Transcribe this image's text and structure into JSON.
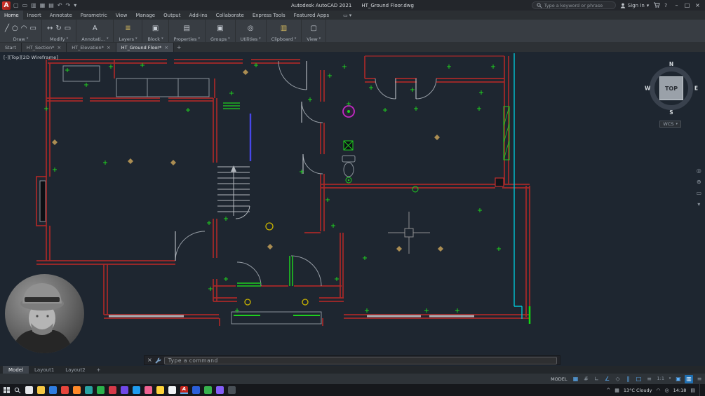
{
  "titlebar": {
    "app_name": "Autodesk AutoCAD 2021",
    "doc_name": "HT_Ground Floor.dwg",
    "search_placeholder": "Type a keyword or phrase",
    "sign_in": "Sign In"
  },
  "icons": {
    "close": "×",
    "minimize": "–",
    "maximize": "□",
    "dropdown": "▾",
    "add": "+",
    "undo": "↶",
    "redo": "↷",
    "new_file": "▢",
    "open_file": "▭",
    "save": "▥",
    "save_all": "▦",
    "plot": "▤",
    "help": "?",
    "caret_up": "^",
    "wheel": "◎",
    "pan": "⊕",
    "zoom_nav": "▭",
    "orbit": "◠",
    "toggle_panel": "▭"
  },
  "menubar": {
    "tabs": [
      {
        "label": "Home"
      },
      {
        "label": "Insert"
      },
      {
        "label": "Annotate"
      },
      {
        "label": "Parametric"
      },
      {
        "label": "View"
      },
      {
        "label": "Manage"
      },
      {
        "label": "Output"
      },
      {
        "label": "Add-ins"
      },
      {
        "label": "Collaborate"
      },
      {
        "label": "Express Tools"
      },
      {
        "label": "Featured Apps"
      }
    ]
  },
  "ribbon": {
    "panels": [
      {
        "label": "Draw",
        "tools": [
          "╱",
          "○",
          "◠",
          "▭"
        ]
      },
      {
        "label": "Modify",
        "tools": [
          "↔",
          "↻",
          "▭"
        ]
      },
      {
        "label": "Annotati...",
        "tools": [
          "A"
        ]
      },
      {
        "label": "Layers",
        "tools": [
          "≣"
        ]
      },
      {
        "label": "Block",
        "tools": [
          "▣"
        ]
      },
      {
        "label": "Properties",
        "tools": [
          "▤"
        ]
      },
      {
        "label": "Groups",
        "tools": [
          "▣"
        ]
      },
      {
        "label": "Utilities",
        "tools": [
          "◎"
        ]
      },
      {
        "label": "Clipboard",
        "tools": [
          "▥"
        ]
      },
      {
        "label": "View",
        "tools": [
          "▢"
        ]
      }
    ]
  },
  "file_tabs": {
    "tabs": [
      {
        "label": "Start"
      },
      {
        "label": "HT_Section*"
      },
      {
        "label": "HT_Elevation*"
      },
      {
        "label": "HT_Ground Floor*"
      }
    ]
  },
  "viewport": {
    "controls": "[-][Top][2D Wireframe]",
    "cube": {
      "n": "N",
      "e": "E",
      "s": "S",
      "w": "W",
      "face": "TOP"
    },
    "ucs": "WCS"
  },
  "command": {
    "placeholder": "Type a command"
  },
  "layouts": {
    "tabs": [
      {
        "label": "Model"
      },
      {
        "label": "Layout1"
      },
      {
        "label": "Layout2"
      }
    ]
  },
  "status": {
    "model": "MODEL",
    "scale_caret": "▾",
    "icons": [
      {
        "g": "▦"
      },
      {
        "g": "#"
      },
      {
        "g": "∟"
      },
      {
        "g": "∠"
      },
      {
        "g": "◇"
      },
      {
        "g": "∥"
      },
      {
        "g": "□"
      },
      {
        "g": "≡"
      },
      {
        "g": "1:1"
      },
      {
        "g": "▣"
      },
      {
        "g": "▥"
      },
      {
        "g": "≡"
      }
    ]
  },
  "taskbar": {
    "weather": "13°C Cloudy",
    "time": "14:18",
    "apps": [
      {
        "color": "#e5e7ea",
        "glyph": ""
      },
      {
        "color": "#f6c844",
        "glyph": ""
      },
      {
        "color": "#2f7de1",
        "glyph": ""
      },
      {
        "color": "#e8453c",
        "glyph": ""
      },
      {
        "color": "#ff8a2a",
        "glyph": ""
      },
      {
        "color": "#29a3a3",
        "glyph": ""
      },
      {
        "color": "#2bb24c",
        "glyph": ""
      },
      {
        "color": "#d73a49",
        "glyph": ""
      },
      {
        "color": "#7048e8",
        "glyph": ""
      },
      {
        "color": "#1f9cf0",
        "glyph": ""
      },
      {
        "color": "#f06292",
        "glyph": ""
      },
      {
        "color": "#ffd43b",
        "glyph": ""
      },
      {
        "color": "#f1f3f5",
        "glyph": ""
      },
      {
        "color": "#c4251d",
        "glyph": "A"
      },
      {
        "color": "#2b5fd9",
        "glyph": ""
      },
      {
        "color": "#37b24d",
        "glyph": ""
      },
      {
        "color": "#845ef7",
        "glyph": ""
      },
      {
        "color": "#495057",
        "glyph": ""
      }
    ]
  },
  "colors": {
    "wall_red": "#a82828",
    "accent_green": "#1fcf1f",
    "cyan": "#00c4d4",
    "magenta": "#c42ac4",
    "yellow": "#c9b400",
    "tan": "#ab8d52",
    "blue_line": "#4747e8",
    "canvas_bg": "#1e2630"
  }
}
